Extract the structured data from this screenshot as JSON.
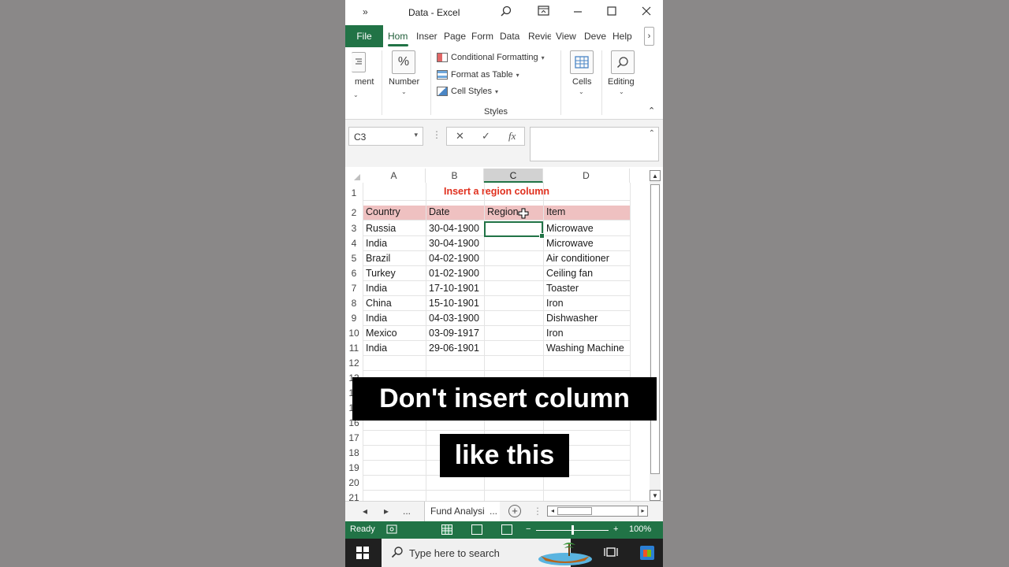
{
  "window": {
    "title": "Data  -  Excel",
    "chevrons_label": "»"
  },
  "ribbon_tabs": {
    "file": "File",
    "items": [
      "Hom",
      "Inser",
      "Page",
      "Form",
      "Data",
      "Revie",
      "View",
      "Deve",
      "Help"
    ],
    "active": "Hom",
    "more": "›"
  },
  "ribbon": {
    "alignment_label": "ment",
    "number_label": "Number",
    "number_icon": "%",
    "styles": {
      "conditional_formatting": "Conditional Formatting",
      "format_as_table": "Format as Table",
      "cell_styles": "Cell Styles",
      "group_label": "Styles"
    },
    "cells_label": "Cells",
    "editing_label": "Editing"
  },
  "formula_bar": {
    "name_box": "C3",
    "formula": "",
    "cancel_icon": "✕",
    "enter_icon": "✓",
    "fx_icon": "fx"
  },
  "sheet": {
    "columns": [
      "A",
      "B",
      "C",
      "D"
    ],
    "selected_column": "C",
    "active_cell": "C3",
    "row_numbers": [
      "1",
      "2",
      "3",
      "4",
      "5",
      "6",
      "7",
      "8",
      "9",
      "10",
      "11",
      "12",
      "13",
      "14",
      "15",
      "16",
      "17",
      "18",
      "19",
      "20",
      "21"
    ],
    "title": "Insert a region column",
    "headers": [
      "Country",
      "Date",
      "Region",
      "Item"
    ],
    "rows": [
      [
        "Russia",
        "30-04-1900",
        "",
        "Microwave"
      ],
      [
        "India",
        "30-04-1900",
        "",
        "Microwave"
      ],
      [
        "Brazil",
        "04-02-1900",
        "",
        "Air conditioner"
      ],
      [
        "Turkey",
        "01-02-1900",
        "",
        "Ceiling fan"
      ],
      [
        "India",
        "17-10-1901",
        "",
        "Toaster"
      ],
      [
        "China",
        "15-10-1901",
        "",
        "Iron"
      ],
      [
        "India",
        "04-03-1900",
        "",
        "Dishwasher"
      ],
      [
        "Mexico",
        "03-09-1917",
        "",
        "Iron"
      ],
      [
        "India",
        "29-06-1901",
        "",
        "Washing Machine"
      ]
    ],
    "accent_color": "#217346",
    "header_fill": "#efc1c1",
    "title_color": "#e0301e"
  },
  "sheet_tabs": {
    "prev": "◂",
    "next": "▸",
    "ellipsis": "...",
    "active_tab": "Fund Analysi",
    "ellipsis2": "...",
    "add": "+"
  },
  "status_bar": {
    "status": "Ready",
    "zoom": "100%",
    "zoom_fraction": 0.5,
    "minus": "−",
    "plus": "+"
  },
  "taskbar": {
    "search_placeholder": "Type here to search"
  },
  "captions": {
    "line1": "Don't insert column",
    "line2": "like this"
  }
}
